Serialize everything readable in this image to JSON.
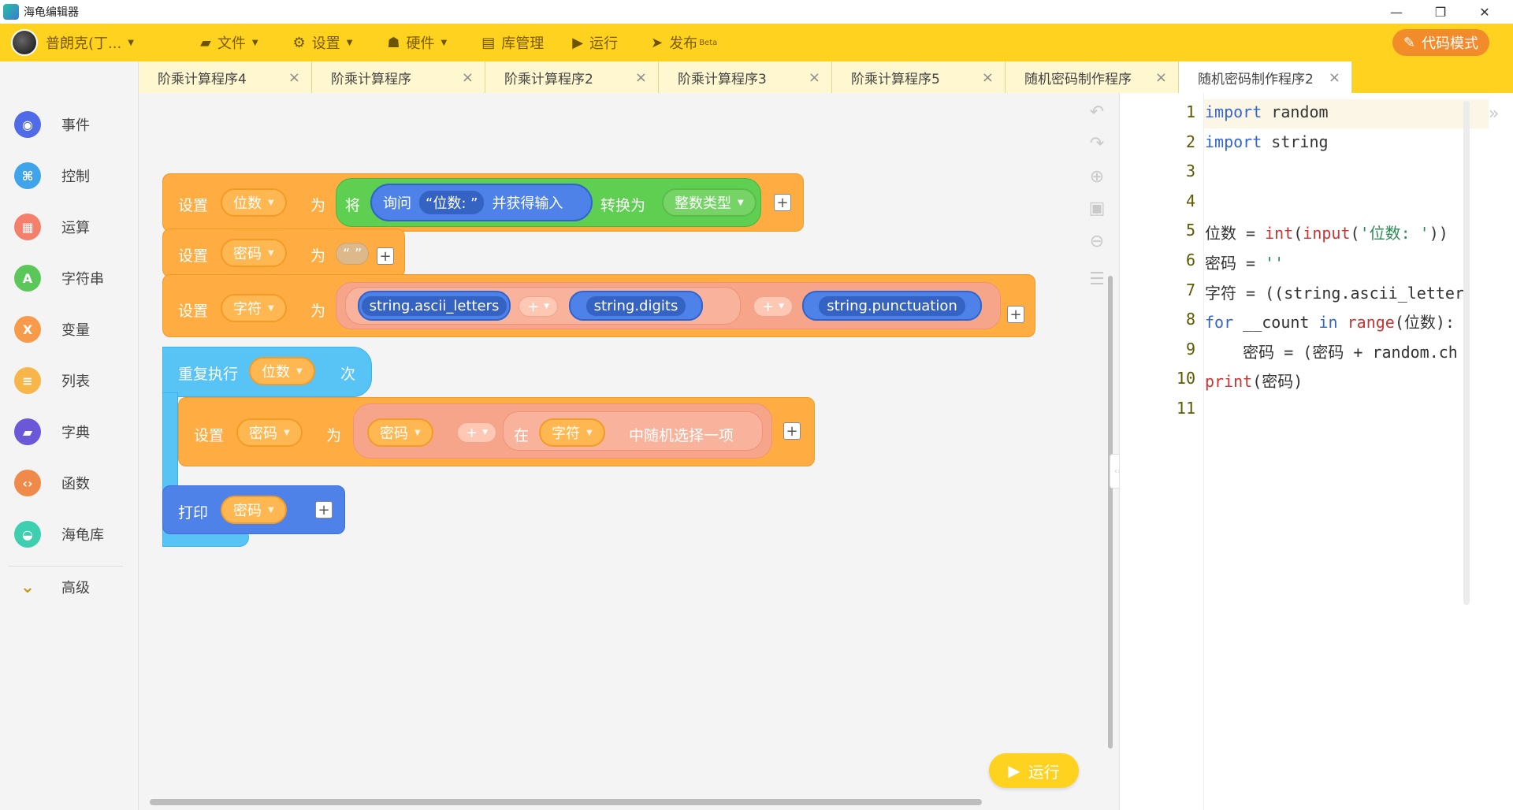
{
  "window": {
    "title": "海龟编辑器",
    "controls": [
      "—",
      "❐",
      "✕"
    ]
  },
  "toolbar": {
    "user": "普朗克(丁...",
    "items": [
      {
        "label": "文件",
        "icon": "folder-icon"
      },
      {
        "label": "设置",
        "icon": "gear-icon"
      },
      {
        "label": "硬件",
        "icon": "robot-icon"
      },
      {
        "label": "库管理",
        "icon": "inbox-icon"
      },
      {
        "label": "运行",
        "icon": "play-icon"
      },
      {
        "label": "发布",
        "icon": "send-icon",
        "badge": "Beta"
      }
    ],
    "code_mode": "代码模式"
  },
  "tabs": [
    {
      "label": "阶乘计算程序4"
    },
    {
      "label": "阶乘计算程序"
    },
    {
      "label": "阶乘计算程序2"
    },
    {
      "label": "阶乘计算程序3"
    },
    {
      "label": "阶乘计算程序5"
    },
    {
      "label": "随机密码制作程序"
    },
    {
      "label": "随机密码制作程序2",
      "active": true
    }
  ],
  "sidebar": {
    "categories": [
      {
        "label": "事件",
        "color": "#4f6be8"
      },
      {
        "label": "控制",
        "color": "#3fa4ea"
      },
      {
        "label": "运算",
        "color": "#f47f6a"
      },
      {
        "label": "字符串",
        "color": "#5bc75a"
      },
      {
        "label": "变量",
        "color": "#f79a4a"
      },
      {
        "label": "列表",
        "color": "#f7b64a"
      },
      {
        "label": "字典",
        "color": "#6b58d8"
      },
      {
        "label": "函数",
        "color": "#ef8a4a"
      },
      {
        "label": "海龟库",
        "color": "#3dcfb0"
      }
    ],
    "advanced": "高级"
  },
  "blocks": {
    "set": "设置",
    "to": "为",
    "var_digits": "位数",
    "var_password": "密码",
    "var_chars": "字符",
    "convert_will": "将",
    "ask": "询问",
    "ask_prompt": "“位数: ”",
    "and_get_input": "并获得输入",
    "convert_to": "转换为",
    "int_type": "整数类型",
    "empty_str": "“ ”",
    "ascii_letters": "string.ascii_letters",
    "digits": "string.digits",
    "punctuation": "string.punctuation",
    "op_plus": "+",
    "repeat": "重复执行",
    "times": "次",
    "in": "在",
    "random_choice": "中随机选择一项",
    "print": "打印"
  },
  "run_button": "运行",
  "code_lines": [
    {
      "n": "1",
      "html": "<span class='kw'>import</span> random"
    },
    {
      "n": "2",
      "html": "<span class='kw'>import</span> string"
    },
    {
      "n": "3",
      "html": ""
    },
    {
      "n": "4",
      "html": ""
    },
    {
      "n": "5",
      "html": "位数 = <span class='fn'>int</span>(<span class='fn'>input</span>(<span class='str'>'位数: '</span>))"
    },
    {
      "n": "6",
      "html": "密码 = <span class='str'>''</span>"
    },
    {
      "n": "7",
      "html": "字符 = ((string.ascii_letter"
    },
    {
      "n": "8",
      "html": "<span class='kw'>for</span> __count <span class='kw'>in</span> <span class='fn'>range</span>(位数):"
    },
    {
      "n": "9",
      "html": "    密码 = (密码 + random.ch"
    },
    {
      "n": "10",
      "html": "<span class='fn'>print</span>(密码)"
    },
    {
      "n": "11",
      "html": ""
    }
  ]
}
